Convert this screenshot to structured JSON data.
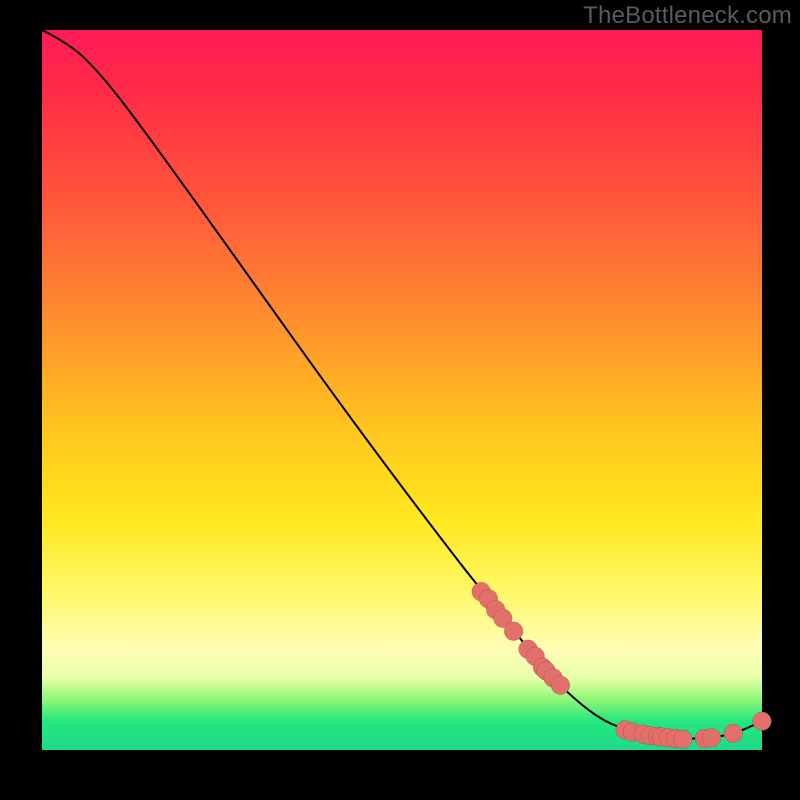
{
  "watermark": "TheBottleneck.com",
  "colors": {
    "dot": "#e36f6a",
    "line": "#000000"
  },
  "chart_data": {
    "type": "line",
    "title": "",
    "xlabel": "",
    "ylabel": "",
    "xlim": [
      0,
      100
    ],
    "ylim": [
      0,
      100
    ],
    "grid": false,
    "legend": false,
    "curve": [
      {
        "x": 0,
        "y": 100
      },
      {
        "x": 4,
        "y": 98
      },
      {
        "x": 8,
        "y": 94
      },
      {
        "x": 12,
        "y": 89
      },
      {
        "x": 20,
        "y": 78
      },
      {
        "x": 30,
        "y": 64
      },
      {
        "x": 40,
        "y": 50
      },
      {
        "x": 50,
        "y": 36.5
      },
      {
        "x": 58,
        "y": 26
      },
      {
        "x": 62,
        "y": 21
      },
      {
        "x": 66,
        "y": 16
      },
      {
        "x": 70,
        "y": 11
      },
      {
        "x": 74,
        "y": 7
      },
      {
        "x": 78,
        "y": 4
      },
      {
        "x": 82,
        "y": 2.5
      },
      {
        "x": 86,
        "y": 1.8
      },
      {
        "x": 90,
        "y": 1.5
      },
      {
        "x": 94,
        "y": 1.8
      },
      {
        "x": 97,
        "y": 2.6
      },
      {
        "x": 100,
        "y": 4
      }
    ],
    "points": [
      {
        "x": 61,
        "y": 22
      },
      {
        "x": 62,
        "y": 21
      },
      {
        "x": 63,
        "y": 19.5
      },
      {
        "x": 64,
        "y": 18.3
      },
      {
        "x": 65.5,
        "y": 16.5
      },
      {
        "x": 67.5,
        "y": 14
      },
      {
        "x": 68.5,
        "y": 13
      },
      {
        "x": 69.5,
        "y": 11.5
      },
      {
        "x": 70,
        "y": 11
      },
      {
        "x": 71,
        "y": 10
      },
      {
        "x": 72,
        "y": 9
      },
      {
        "x": 81,
        "y": 2.8
      },
      {
        "x": 82,
        "y": 2.5
      },
      {
        "x": 83.5,
        "y": 2.2
      },
      {
        "x": 84.5,
        "y": 2.0
      },
      {
        "x": 85.5,
        "y": 1.9
      },
      {
        "x": 86,
        "y": 1.8
      },
      {
        "x": 87,
        "y": 1.7
      },
      {
        "x": 88,
        "y": 1.6
      },
      {
        "x": 89,
        "y": 1.5
      },
      {
        "x": 92,
        "y": 1.6
      },
      {
        "x": 93,
        "y": 1.7
      },
      {
        "x": 96,
        "y": 2.3
      },
      {
        "x": 100,
        "y": 4
      }
    ]
  }
}
